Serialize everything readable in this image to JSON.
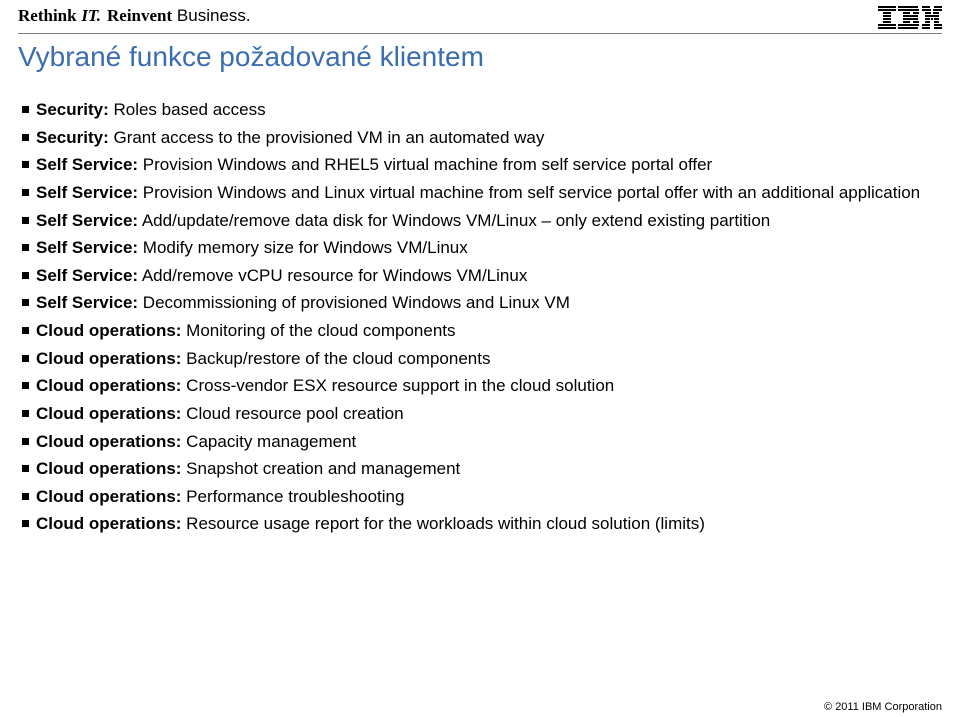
{
  "header": {
    "tagline_part1": "Rethink",
    "tagline_part2": "IT.",
    "tagline_part3a": "Reinvent",
    "tagline_part3b": "Business."
  },
  "title": "Vybrané funkce požadované klientem",
  "bullets": [
    {
      "lead": "Security:",
      "rest": " Roles based access"
    },
    {
      "lead": "Security:",
      "rest": " Grant access to the provisioned VM in an automated way"
    },
    {
      "lead": "Self Service:",
      "rest": " Provision Windows and RHEL5 virtual machine from self service portal offer"
    },
    {
      "lead": "Self Service:",
      "rest": " Provision Windows and Linux virtual machine from self service portal offer with an additional application"
    },
    {
      "lead": "Self Service:",
      "rest": " Add/update/remove data disk for Windows VM/Linux – only extend existing partition"
    },
    {
      "lead": "Self Service:",
      "rest": " Modify memory size for Windows VM/Linux"
    },
    {
      "lead": "Self Service:",
      "rest": " Add/remove vCPU resource for Windows VM/Linux"
    },
    {
      "lead": "Self Service:",
      "rest": " Decommissioning of provisioned Windows and Linux VM"
    },
    {
      "lead": "Cloud operations:",
      "rest": " Monitoring of the cloud components"
    },
    {
      "lead": "Cloud operations:",
      "rest": " Backup/restore of the cloud components"
    },
    {
      "lead": "Cloud operations:",
      "rest": " Cross-vendor ESX resource support in the cloud solution"
    },
    {
      "lead": "Cloud operations:",
      "rest": " Cloud resource pool creation"
    },
    {
      "lead": "Cloud operations:",
      "rest": " Capacity management"
    },
    {
      "lead": "Cloud operations:",
      "rest": " Snapshot creation and management"
    },
    {
      "lead": "Cloud operations:",
      "rest": " Performance troubleshooting"
    },
    {
      "lead": "Cloud operations:",
      "rest": " Resource usage report for the workloads within cloud solution (limits)"
    }
  ],
  "footer": "© 2011 IBM Corporation"
}
